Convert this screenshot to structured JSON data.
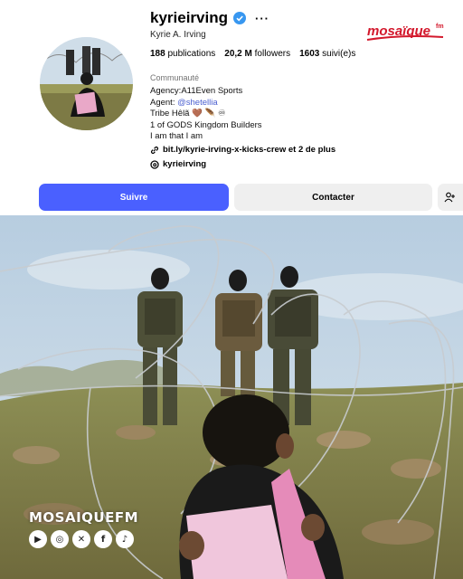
{
  "profile": {
    "username": "kyrieirving",
    "full_name": "Kyrie A. Irving",
    "stats": {
      "posts_count": "188",
      "posts_label": "publications",
      "followers_count": "20,2 M",
      "followers_label": "followers",
      "following_count": "1603",
      "following_label": "suivi(e)s"
    },
    "category": "Communauté",
    "bio": {
      "line1": "Agency:A11Even Sports",
      "agent_prefix": "Agent: ",
      "agent_handle": "@shetellia",
      "line3": "Tribe Hêlã 🤎 🪶 ♾",
      "line4": "1 of GODS Kingdom Builders",
      "line5": "I am that I am"
    },
    "link": "bit.ly/kyrie-irving-x-kicks-crew et 2 de plus",
    "threads_handle": "kyrieirving"
  },
  "actions": {
    "follow_label": "Suivre",
    "contact_label": "Contacter"
  },
  "brand": {
    "logo_text": "mosaïque",
    "logo_suffix": "fm",
    "watermark": "MOSAIQUEFM"
  },
  "icons": [
    "verified-badge-icon",
    "more-options-icon",
    "link-icon",
    "threads-icon",
    "add-user-icon",
    "youtube-icon",
    "instagram-icon",
    "x-icon",
    "facebook-icon",
    "tiktok-icon"
  ],
  "colors": {
    "follow_blue": "#4a60ff",
    "brand_red": "#d3182c",
    "mention_blue": "#4a5ecf"
  }
}
